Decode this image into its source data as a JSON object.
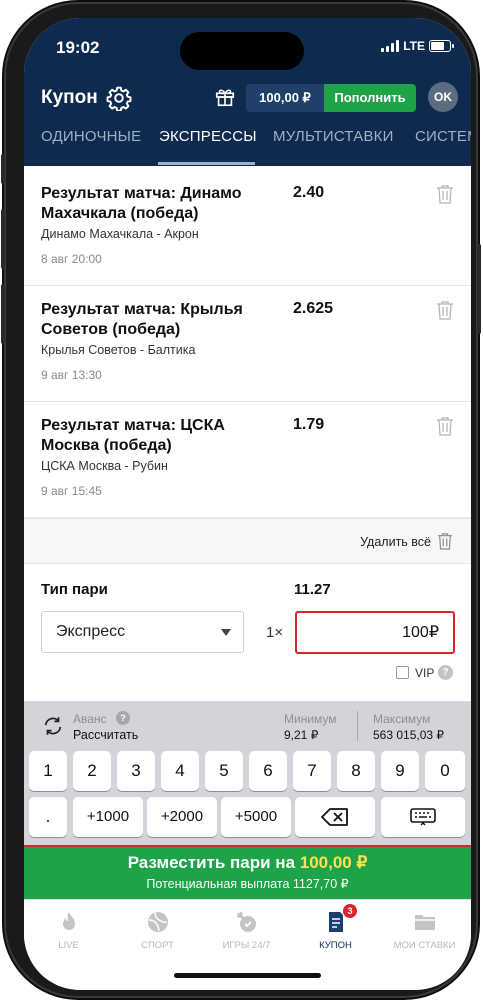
{
  "status": {
    "time": "19:02",
    "network": "LTE"
  },
  "header": {
    "title": "Купон",
    "balance": "100,00 ₽",
    "topup_label": "Пополнить",
    "avatar_initials": "OK"
  },
  "tabs": [
    {
      "label": "ОДИНОЧНЫЕ",
      "active": false
    },
    {
      "label": "ЭКСПРЕССЫ",
      "active": true
    },
    {
      "label": "МУЛЬТИСТАВКИ",
      "active": false
    },
    {
      "label": "СИСТЕМ",
      "active": false
    }
  ],
  "bets": [
    {
      "title": "Результат матча: Динамо Махачкала (победа)",
      "odds": "2.40",
      "teams": "Динамо Махачкала - Акрон",
      "date": "8 авг 20:00"
    },
    {
      "title": "Результат матча: Крылья Советов (победа)",
      "odds": "2.625",
      "teams": "Крылья Советов - Балтика",
      "date": "9 авг 13:30"
    },
    {
      "title": "Результат матча: ЦСКА Москва (победа)",
      "odds": "1.79",
      "teams": "ЦСКА Москва - Рубин",
      "date": "9 авг 15:45"
    }
  ],
  "coupon": {
    "delete_all": "Удалить всё",
    "bet_type_label": "Тип пари",
    "total_odds": "11.27",
    "bet_type_value": "Экспресс",
    "multiplier": "1×",
    "stake": "100₽",
    "vip_label": "VIP",
    "help": "?"
  },
  "keyboard": {
    "avans_label": "Аванс",
    "calc_label": "Рассчитать",
    "min_label": "Минимум",
    "min_value": "9,21 ₽",
    "max_label": "Максимум",
    "max_value": "563 015,03 ₽",
    "digits": [
      "1",
      "2",
      "3",
      "4",
      "5",
      "6",
      "7",
      "8",
      "9",
      "0"
    ],
    "dot": ".",
    "quick": [
      "+1000",
      "+2000",
      "+5000"
    ]
  },
  "place_bet": {
    "label": "Разместить пари на",
    "amount": "100,00 ₽",
    "payout": "Потенциальная выплата 1127,70 ₽"
  },
  "nav": [
    {
      "label": "LIVE",
      "icon": "flame-icon"
    },
    {
      "label": "СПОРТ",
      "icon": "ball-icon"
    },
    {
      "label": "ИГРЫ 24/7",
      "icon": "games-icon"
    },
    {
      "label": "КУПОН",
      "icon": "coupon-icon",
      "badge": "3",
      "active": true
    },
    {
      "label": "МОИ СТАВКИ",
      "icon": "folder-icon"
    }
  ],
  "colors": {
    "header": "#0e2a4e",
    "accent_green": "#1fa348",
    "accent_red": "#d9252e",
    "amount_yellow": "#ffe14d"
  }
}
